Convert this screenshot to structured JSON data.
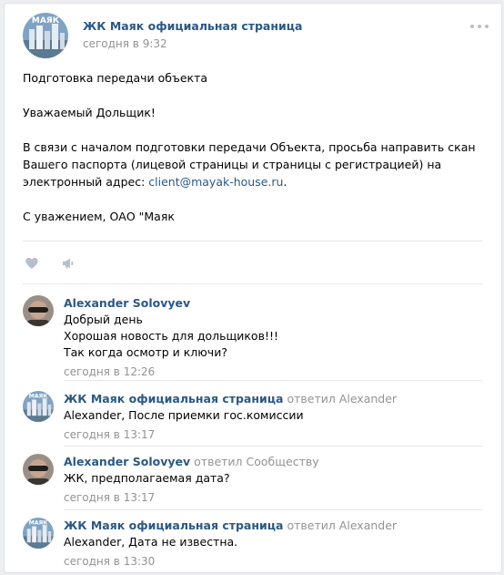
{
  "post": {
    "author": "ЖК Маяк официальная страница",
    "avatar_logo": "МАЯК",
    "time": "сегодня в 9:32",
    "paragraphs": [
      "Подготовка передачи объекта",
      "Уважаемый Дольщик!"
    ],
    "body_text": "В связи с началом подготовки передачи Объекта, просьба направить скан Вашего паспорта (лицевой страницы и страницы с регистрацией) на электронный адрес:",
    "email": "client@mayak-house.ru",
    "email_suffix": ".",
    "signature": "С уважением, ОАО \"Маяк"
  },
  "icons": {
    "like": "heart-icon",
    "share": "megaphone-icon",
    "more": "more-dots-icon"
  },
  "comments": [
    {
      "author": "Alexander Solovyev",
      "reply_to": "",
      "lines": [
        "Добрый день",
        "Хорошая новость для дольщиков!!!",
        "Так когда осмотр и ключи?"
      ],
      "time": "сегодня в 12:26",
      "avatar": "person"
    },
    {
      "author": "ЖК Маяк официальная страница",
      "reply_to": "ответил Alexander",
      "lines": [
        "Alexander, После приемки гос.комиссии"
      ],
      "time": "сегодня в 13:17",
      "avatar": "logo"
    },
    {
      "author": "Alexander Solovyev",
      "reply_to": "ответил Сообществу",
      "lines": [
        "ЖК, предполагаемая дата?"
      ],
      "time": "сегодня в 13:17",
      "avatar": "person"
    },
    {
      "author": "ЖК Маяк официальная страница",
      "reply_to": "ответил Alexander",
      "lines": [
        "Alexander, Дата не известна."
      ],
      "time": "сегодня в 13:30",
      "avatar": "logo"
    }
  ],
  "colors": {
    "link": "#2a5885",
    "meta": "#939393",
    "icon": "#b6bfca"
  }
}
